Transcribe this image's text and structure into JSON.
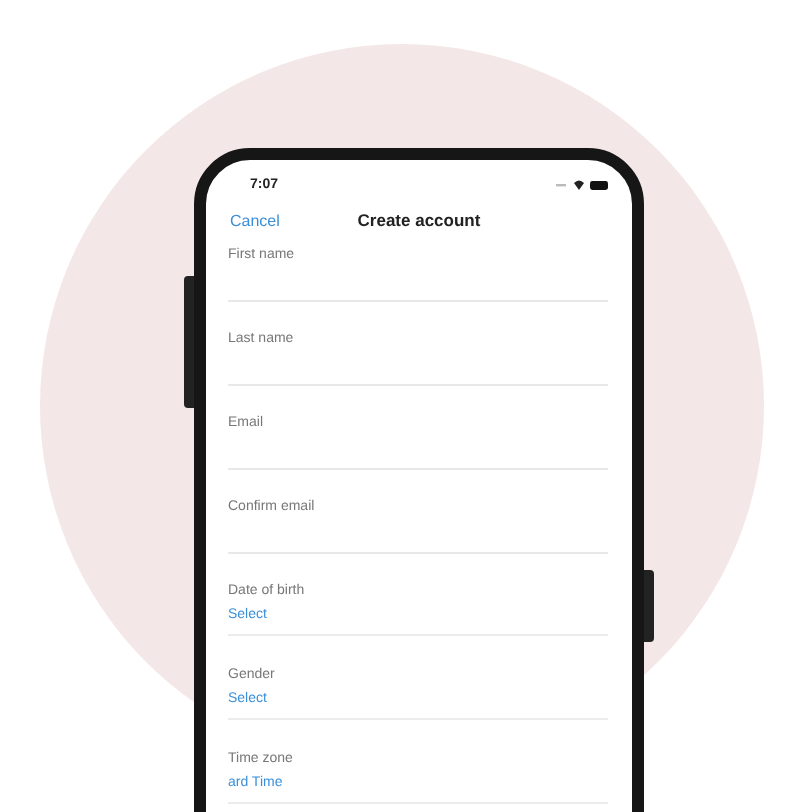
{
  "status_bar": {
    "time": "7:07"
  },
  "nav": {
    "cancel": "Cancel",
    "title": "Create account"
  },
  "fields": [
    {
      "kind": "text",
      "label": "First name"
    },
    {
      "kind": "text",
      "label": "Last name"
    },
    {
      "kind": "text",
      "label": "Email"
    },
    {
      "kind": "text",
      "label": "Confirm email"
    },
    {
      "kind": "select",
      "label": "Date of birth",
      "value": "Select"
    },
    {
      "kind": "select",
      "label": "Gender",
      "value": "Select"
    },
    {
      "kind": "select",
      "label": "Time zone",
      "value": "ard Time"
    }
  ]
}
